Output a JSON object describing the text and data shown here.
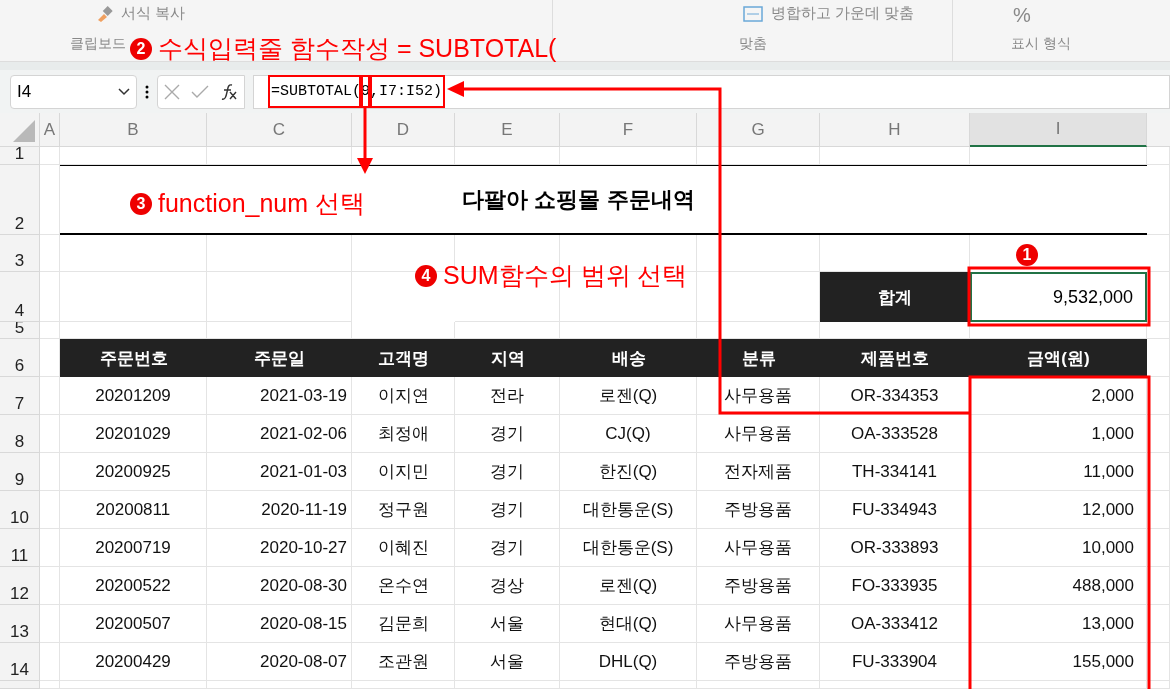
{
  "ribbon": {
    "format_painter": "서식 복사",
    "merge_button": "병합하고 가운데 맞춤",
    "percent": "%",
    "groups": [
      {
        "label": "클립보드"
      },
      {
        "label": "맞춤"
      },
      {
        "label": "표시 형식"
      }
    ]
  },
  "formula_bar": {
    "name_box": "I4",
    "formula": "=SUBTOTAL(9,I7:I52)"
  },
  "columns": [
    {
      "label": "A",
      "selected": false
    },
    {
      "label": "B",
      "selected": false
    },
    {
      "label": "C",
      "selected": false
    },
    {
      "label": "D",
      "selected": false
    },
    {
      "label": "E",
      "selected": false
    },
    {
      "label": "F",
      "selected": false
    },
    {
      "label": "G",
      "selected": false
    },
    {
      "label": "H",
      "selected": false
    },
    {
      "label": "I",
      "selected": true
    }
  ],
  "row_numbers": [
    "1",
    "2",
    "3",
    "4",
    "5",
    "6",
    "7",
    "8",
    "9",
    "10",
    "11",
    "12",
    "13",
    "14"
  ],
  "sheet": {
    "title": "다팔아 쇼핑몰 주문내역",
    "total_label": "합계",
    "total_value": "9,532,000",
    "headers": [
      "주문번호",
      "주문일",
      "고객명",
      "지역",
      "배송",
      "분류",
      "제품번호",
      "금액(원)"
    ],
    "rows": [
      [
        "20201209",
        "2021-03-19",
        "이지연",
        "전라",
        "로젠(Q)",
        "사무용품",
        "OR-334353",
        "2,000"
      ],
      [
        "20201029",
        "2021-02-06",
        "최정애",
        "경기",
        "CJ(Q)",
        "사무용품",
        "OA-333528",
        "1,000"
      ],
      [
        "20200925",
        "2021-01-03",
        "이지민",
        "경기",
        "한진(Q)",
        "전자제품",
        "TH-334141",
        "11,000"
      ],
      [
        "20200811",
        "2020-11-19",
        "정구원",
        "경기",
        "대한통운(S)",
        "주방용품",
        "FU-334943",
        "12,000"
      ],
      [
        "20200719",
        "2020-10-27",
        "이혜진",
        "경기",
        "대한통운(S)",
        "사무용품",
        "OR-333893",
        "10,000"
      ],
      [
        "20200522",
        "2020-08-30",
        "온수연",
        "경상",
        "로젠(Q)",
        "주방용품",
        "FO-333935",
        "488,000"
      ],
      [
        "20200507",
        "2020-08-15",
        "김문희",
        "서울",
        "현대(Q)",
        "사무용품",
        "OA-333412",
        "13,000"
      ],
      [
        "20200429",
        "2020-08-07",
        "조관원",
        "서울",
        "DHL(Q)",
        "주방용품",
        "FU-333904",
        "155,000"
      ]
    ]
  },
  "annotations": [
    {
      "marker": "2",
      "text": "수식입력줄 함수작성 = SUBTOTAL("
    },
    {
      "marker": "3",
      "text": "function_num 선택"
    },
    {
      "marker": "4",
      "text": "SUM함수의 범위 선택"
    },
    {
      "marker": "1"
    }
  ]
}
